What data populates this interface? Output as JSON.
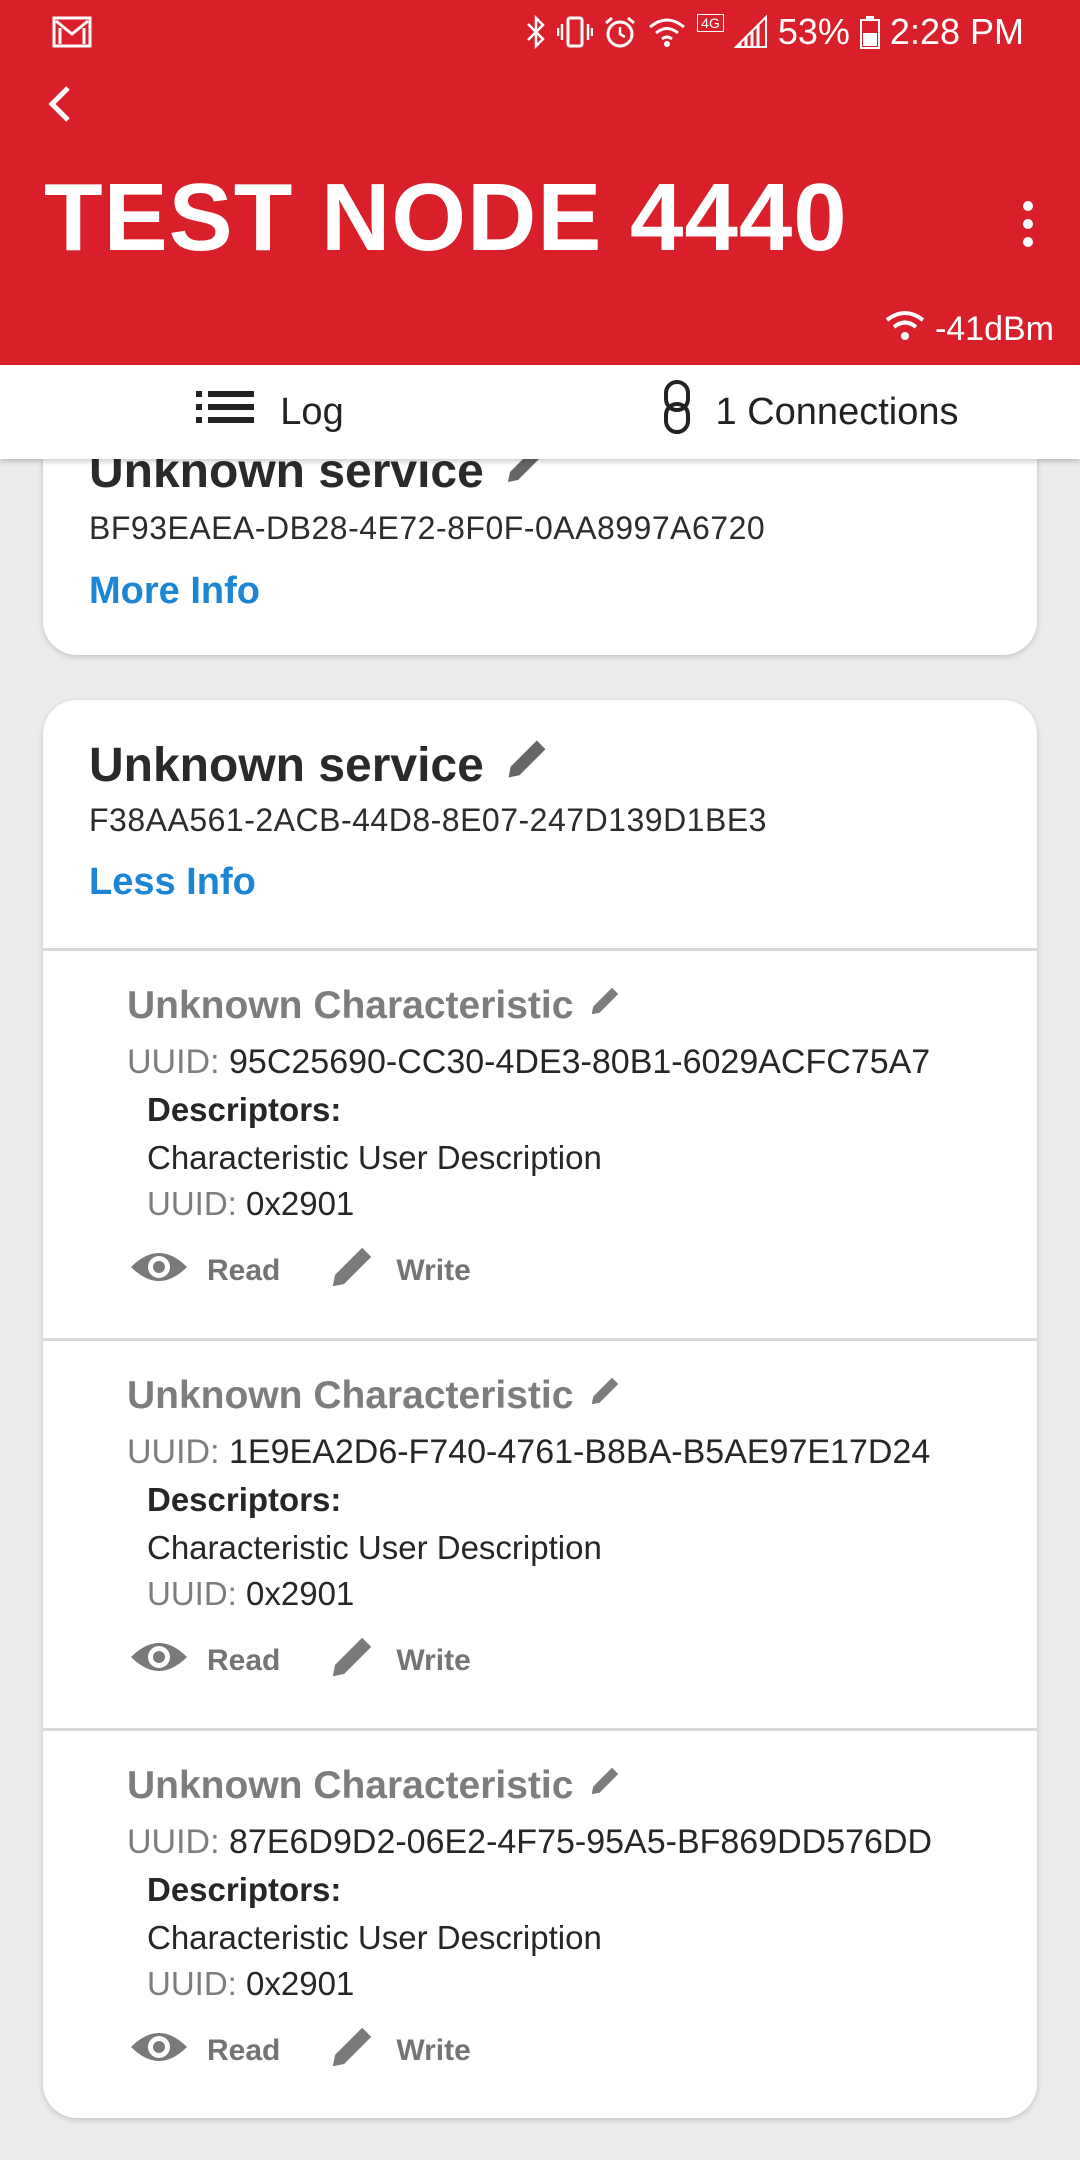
{
  "status_bar": {
    "battery": "53%",
    "time": "2:28 PM",
    "network": "4G",
    "icons": [
      "gmail-icon",
      "bluetooth-icon",
      "vibrate-icon",
      "alarm-icon",
      "wifi-icon",
      "signal-icon",
      "battery-icon"
    ]
  },
  "header": {
    "title": "TEST NODE 4440",
    "rssi": "-41dBm",
    "accent": "#d81f2a"
  },
  "tabs": {
    "log": "Log",
    "connections": "1 Connections"
  },
  "services": [
    {
      "name": "Unknown service",
      "uuid": "BF93EAEA-DB28-4E72-8F0F-0AA8997A6720",
      "toggle": "More Info"
    },
    {
      "name": "Unknown service",
      "uuid": "F38AA561-2ACB-44D8-8E07-247D139D1BE3",
      "toggle": "Less Info",
      "characteristics": [
        {
          "name": "Unknown Characteristic",
          "uuid_label": "UUID:",
          "uuid": "95C25690-CC30-4DE3-80B1-6029ACFC75A7",
          "descriptors_label": "Descriptors:",
          "descriptor_name": "Characteristic User Description",
          "descriptor_uuid_label": "UUID:",
          "descriptor_uuid": "0x2901",
          "read": "Read",
          "write": "Write"
        },
        {
          "name": "Unknown Characteristic",
          "uuid_label": "UUID:",
          "uuid": "1E9EA2D6-F740-4761-B8BA-B5AE97E17D24",
          "descriptors_label": "Descriptors:",
          "descriptor_name": "Characteristic User Description",
          "descriptor_uuid_label": "UUID:",
          "descriptor_uuid": "0x2901",
          "read": "Read",
          "write": "Write"
        },
        {
          "name": "Unknown Characteristic",
          "uuid_label": "UUID:",
          "uuid": "87E6D9D2-06E2-4F75-95A5-BF869DD576DD",
          "descriptors_label": "Descriptors:",
          "descriptor_name": "Characteristic User Description",
          "descriptor_uuid_label": "UUID:",
          "descriptor_uuid": "0x2901",
          "read": "Read",
          "write": "Write"
        }
      ]
    }
  ]
}
